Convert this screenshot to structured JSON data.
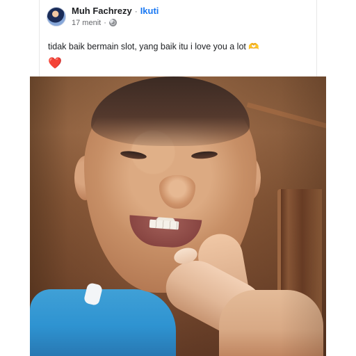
{
  "post": {
    "author_name": "Muh Fachrezy",
    "separator": "·",
    "follow_label": "Ikuti",
    "time_label": "17 menit",
    "meta_separator": "·",
    "message": "tidak baik bermain slot, yang baik itu i love you a lot",
    "heart_symbol": "❤️",
    "reaction_symbol": "🫶"
  },
  "icons": {
    "globe": "globe-icon",
    "heart": "heart-icon",
    "reaction": "heart-hands-icon"
  },
  "colors": {
    "text_primary": "#1c1e21",
    "text_secondary": "#65676b",
    "link_blue": "#1877f2",
    "heart_red": "#e0245e"
  }
}
